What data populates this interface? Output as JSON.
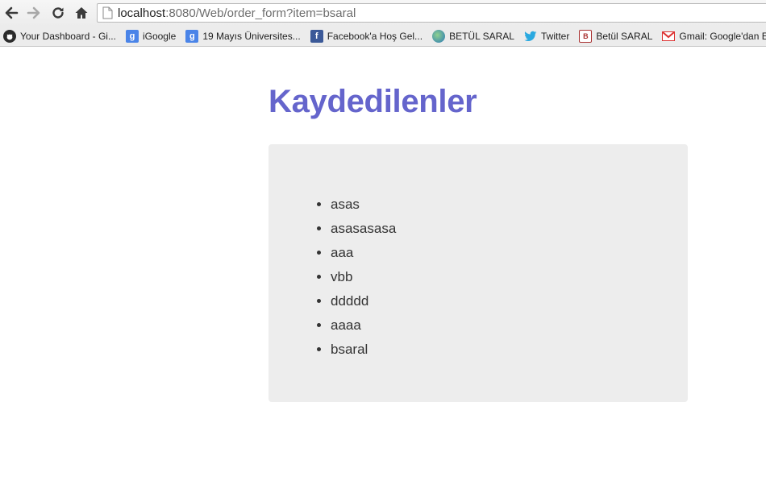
{
  "browser": {
    "url_host": "localhost",
    "url_rest": ":8080/Web/order_form?item=bsaral"
  },
  "bookmarks": [
    {
      "label": "Your Dashboard - Gi...",
      "icon": "github-icon"
    },
    {
      "label": "iGoogle",
      "icon": "google-icon"
    },
    {
      "label": "19 Mayıs Üniversites...",
      "icon": "google-icon"
    },
    {
      "label": "Facebook'a Hoş Gel...",
      "icon": "facebook-icon"
    },
    {
      "label": "BETÜL SARAL",
      "icon": "globe-icon"
    },
    {
      "label": "Twitter",
      "icon": "twitter-icon"
    },
    {
      "label": "Betül SARAL",
      "icon": "blog-icon"
    },
    {
      "label": "Gmail: Google'dan E...",
      "icon": "gmail-icon"
    }
  ],
  "page": {
    "title": "Kaydedilenler",
    "items": [
      "asas",
      "asasasasa",
      "aaa",
      "vbb",
      "ddddd",
      "aaaa",
      "bsaral"
    ]
  },
  "colors": {
    "title": "#6565cc",
    "panel_bg": "#ededed"
  }
}
